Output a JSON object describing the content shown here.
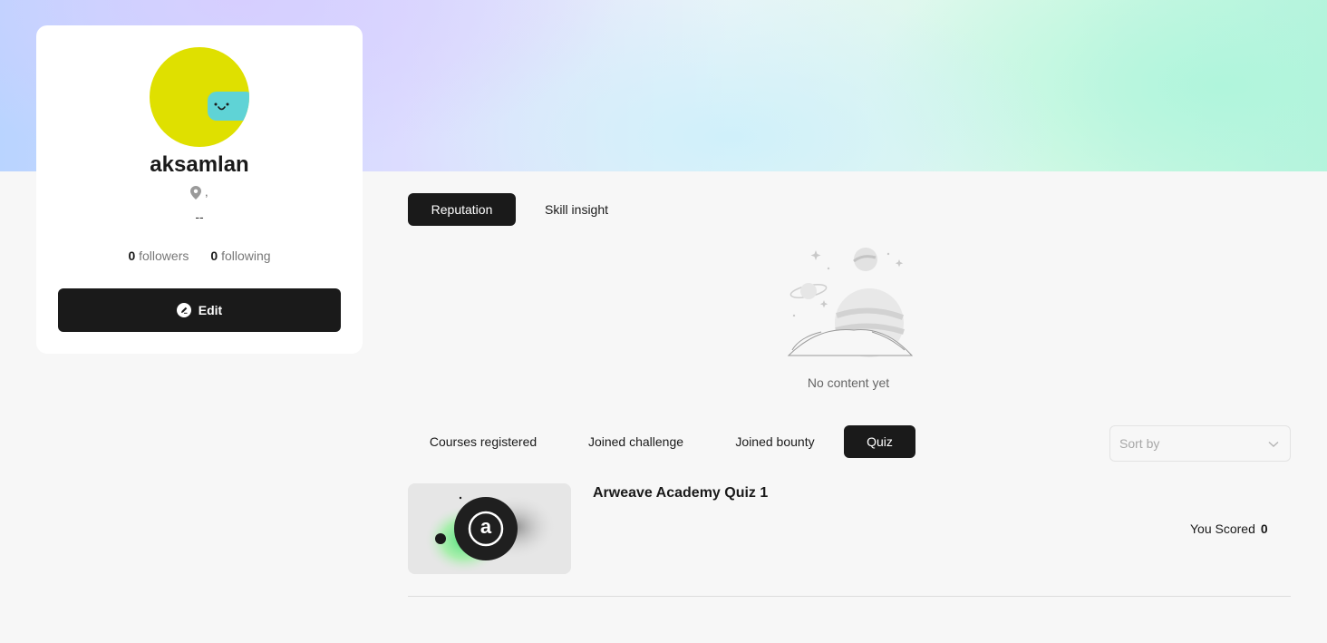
{
  "profile": {
    "username": "aksamlan",
    "location": ",",
    "bio": "--",
    "followers_count": "0",
    "followers_label": "followers",
    "following_count": "0",
    "following_label": "following",
    "edit_label": "Edit",
    "avatar_color": "#dfe000",
    "avatar_face_color": "#5fd3d6"
  },
  "top_tabs": [
    {
      "label": "Reputation",
      "active": true
    },
    {
      "label": "Skill insight",
      "active": false
    }
  ],
  "empty_state": {
    "text": "No content yet"
  },
  "activity_tabs": [
    {
      "label": "Courses registered",
      "active": false
    },
    {
      "label": "Joined challenge",
      "active": false
    },
    {
      "label": "Joined bounty",
      "active": false
    },
    {
      "label": "Quiz",
      "active": true
    }
  ],
  "sort": {
    "placeholder": "Sort by"
  },
  "quiz_list": [
    {
      "title": "Arweave Academy Quiz 1",
      "score_label": "You Scored",
      "score": "0",
      "logo_letter": "a"
    }
  ],
  "colors": {
    "accent": "#1a1a1a",
    "background": "#f7f7f7",
    "card": "#ffffff"
  }
}
